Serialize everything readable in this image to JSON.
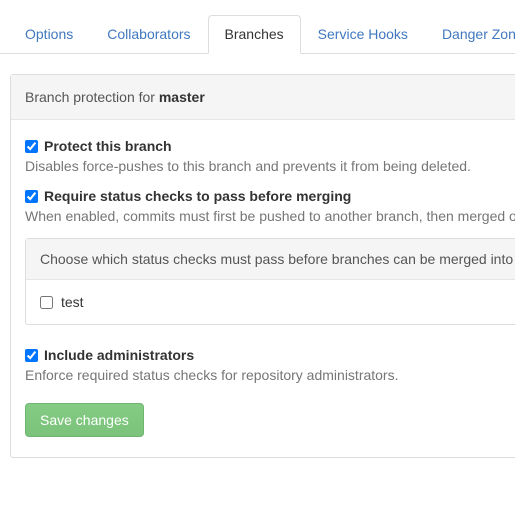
{
  "tabs": {
    "options": "Options",
    "collaborators": "Collaborators",
    "branches": "Branches",
    "service_hooks": "Service Hooks",
    "danger_zone": "Danger Zone"
  },
  "panel": {
    "header_prefix": "Branch protection for ",
    "branch_name": "master"
  },
  "protect": {
    "label": "Protect this branch",
    "desc": "Disables force-pushes to this branch and prevents it from being deleted.",
    "checked": true
  },
  "require_checks": {
    "label": "Require status checks to pass before merging",
    "desc": "When enabled, commits must first be pushed to another branch, then merged or pushed directly to this branch after status checks have passed.",
    "checked": true
  },
  "checks_box": {
    "header": "Choose which status checks must pass before branches can be merged into this branch.",
    "items": [
      {
        "label": "test",
        "checked": false
      }
    ]
  },
  "include_admins": {
    "label": "Include administrators",
    "desc": "Enforce required status checks for repository administrators.",
    "checked": true
  },
  "save_button": "Save changes"
}
